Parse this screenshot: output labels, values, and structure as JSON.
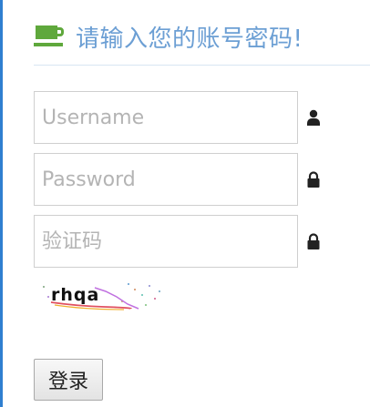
{
  "header": {
    "icon": "coffee-cup-icon",
    "icon_color": "#5fa83c",
    "title": "请输入您的账号密码!",
    "title_color": "#6c9fd4"
  },
  "form": {
    "username": {
      "placeholder": "Username",
      "value": "",
      "icon": "user-icon"
    },
    "password": {
      "placeholder": "Password",
      "value": "",
      "icon": "lock-icon"
    },
    "captcha_input": {
      "placeholder": "验证码",
      "value": "",
      "icon": "lock-icon"
    },
    "captcha_image": {
      "text": "rhqa"
    },
    "login_button": {
      "label": "登录"
    }
  },
  "colors": {
    "left_border": "#2f7fd0",
    "divider": "#d7e6f2",
    "input_border": "#cfcfcf"
  }
}
